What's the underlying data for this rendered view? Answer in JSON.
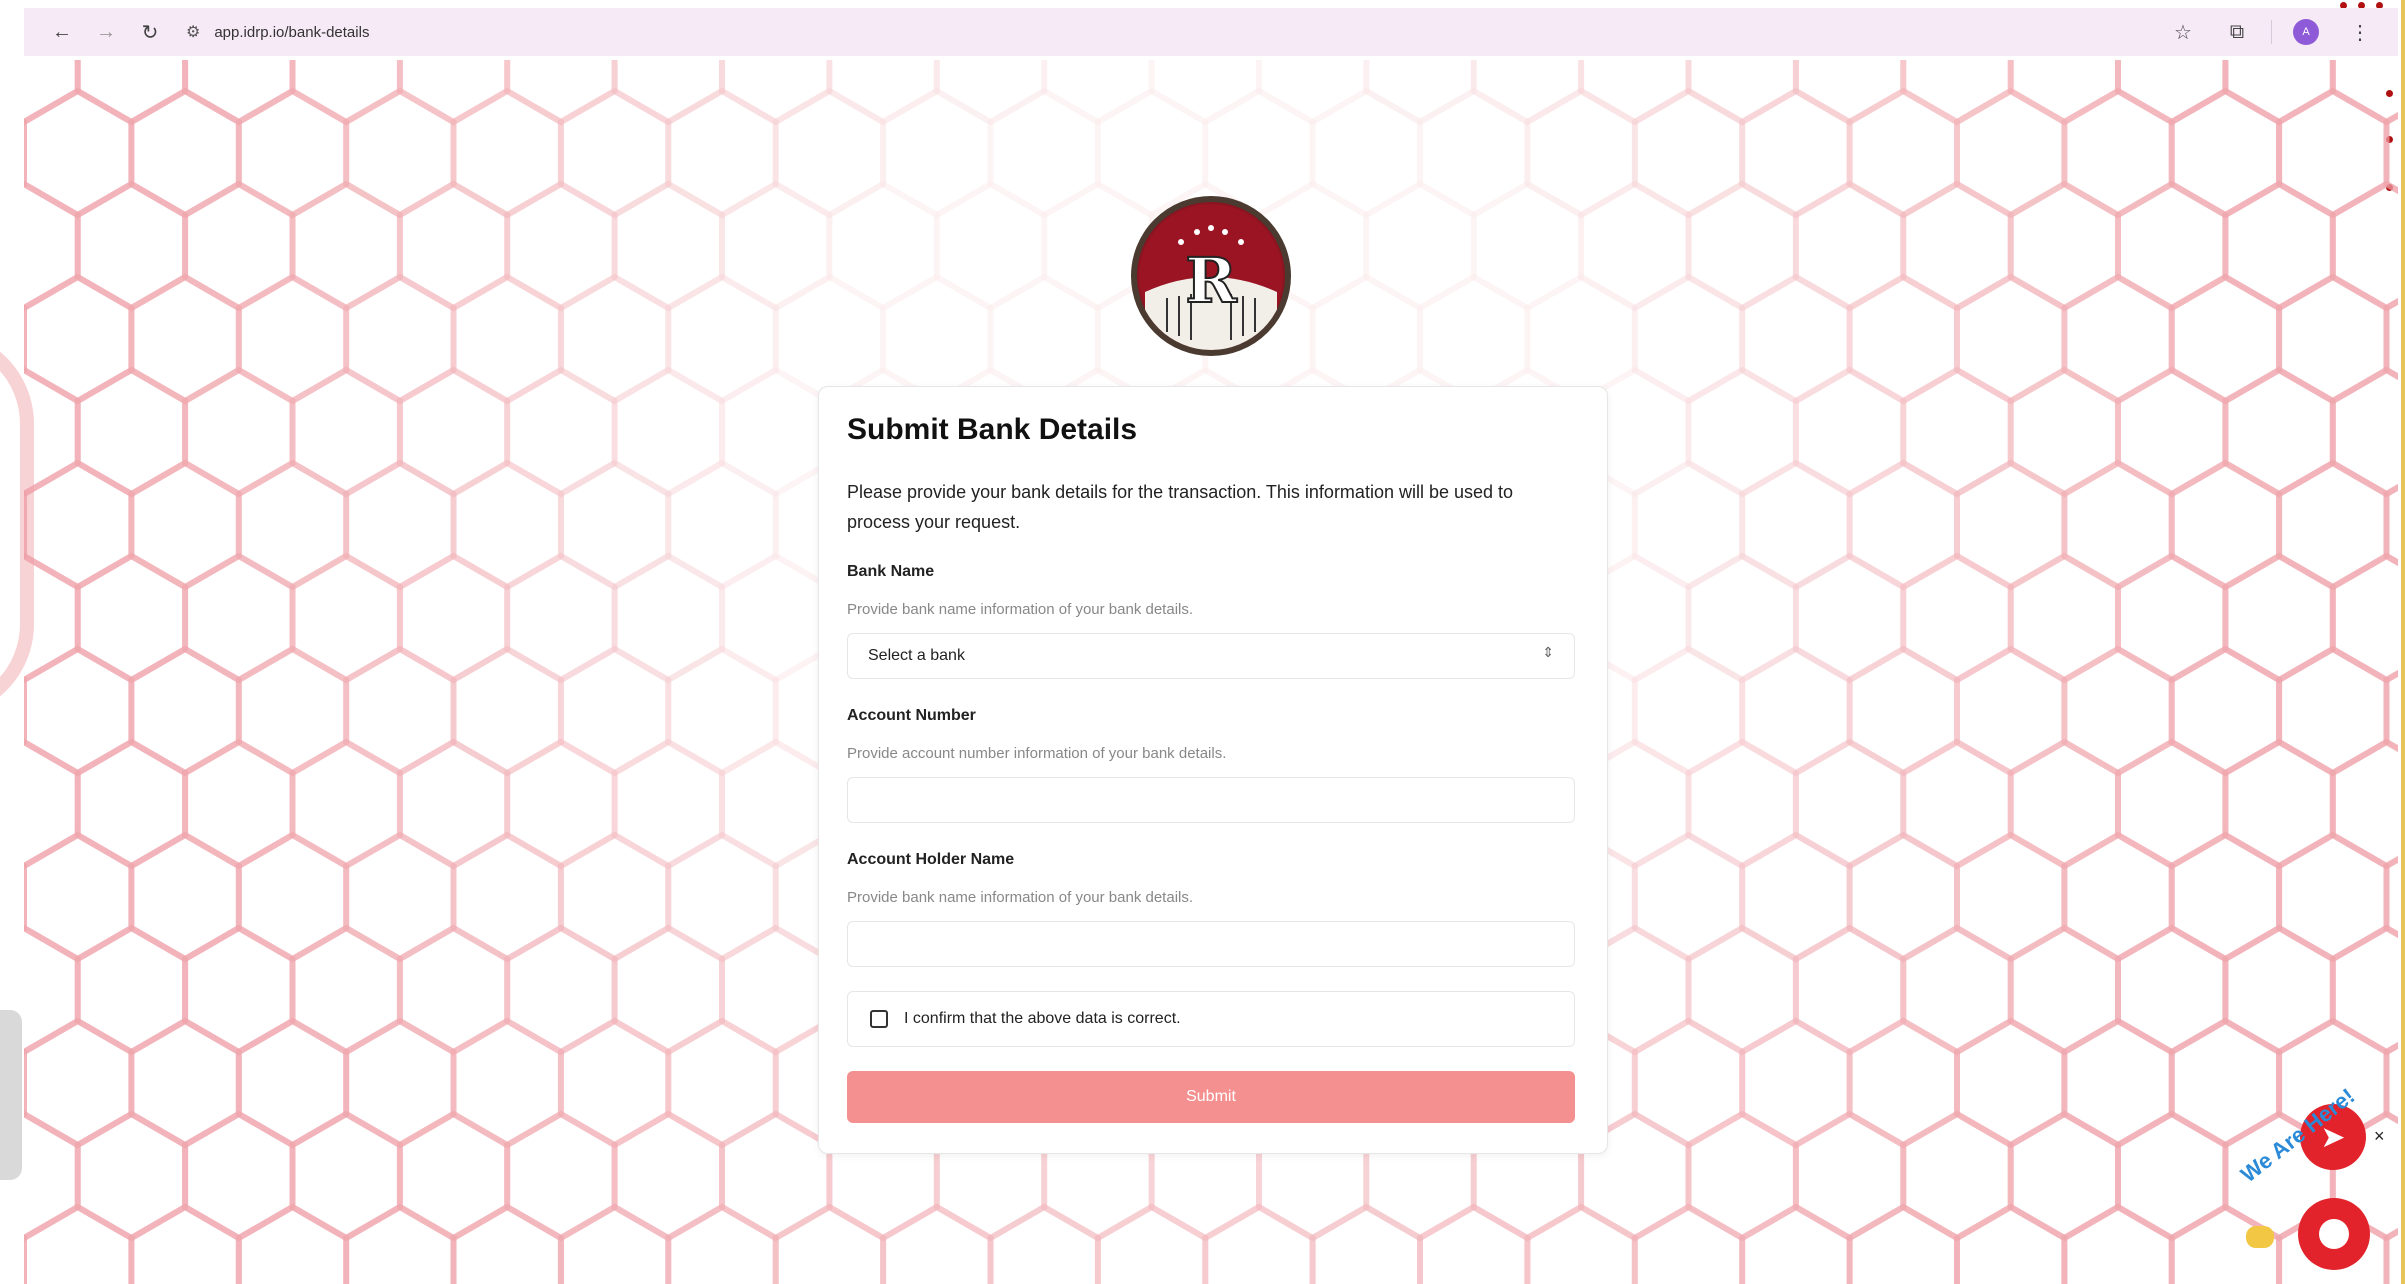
{
  "browser": {
    "url": "app.idrp.io/bank-details"
  },
  "form": {
    "title": "Submit Bank Details",
    "description": "Please provide your bank details for the transaction. This information will be used to process your request.",
    "bank_name": {
      "label": "Bank Name",
      "help": "Provide bank name information of your bank details.",
      "selected": "Select a bank"
    },
    "account_number": {
      "label": "Account Number",
      "help": "Provide account number information of your bank details.",
      "value": ""
    },
    "account_holder": {
      "label": "Account Holder Name",
      "help": "Provide bank name information of your bank details.",
      "value": ""
    },
    "confirm_label": "I confirm that the above data is correct.",
    "submit_label": "Submit"
  },
  "widget": {
    "text": "We Are Here!"
  },
  "colors": {
    "accent": "#f4908f",
    "brand_red": "#e3232b",
    "chrome_bg": "#f6eaf6"
  },
  "icons": [
    "back-arrow-icon",
    "forward-arrow-icon",
    "reload-icon",
    "site-settings-icon",
    "star-icon",
    "extensions-icon",
    "profile-avatar",
    "menu-dots-icon",
    "telegram-icon",
    "close-icon",
    "chat-icon"
  ]
}
